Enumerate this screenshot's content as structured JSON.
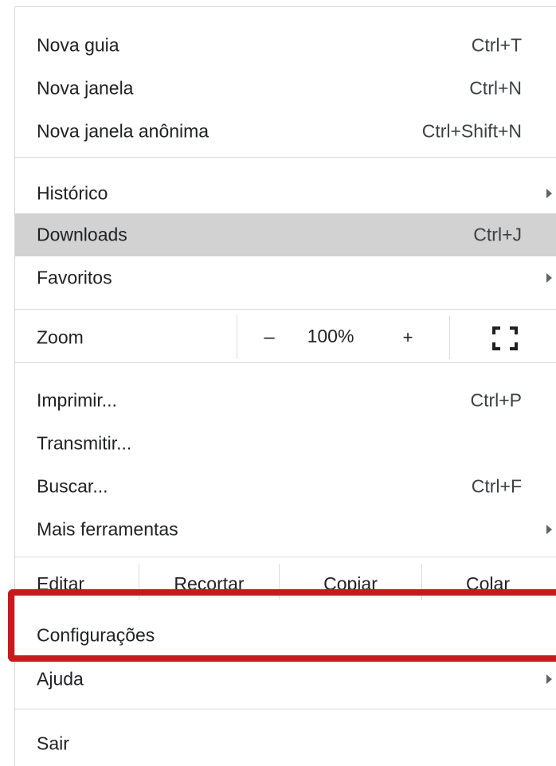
{
  "menu": {
    "new_tab": {
      "label": "Nova guia",
      "shortcut": "Ctrl+T"
    },
    "new_window": {
      "label": "Nova janela",
      "shortcut": "Ctrl+N"
    },
    "incognito": {
      "label": "Nova janela anônima",
      "shortcut": "Ctrl+Shift+N"
    },
    "history": {
      "label": "Histórico"
    },
    "downloads": {
      "label": "Downloads",
      "shortcut": "Ctrl+J"
    },
    "bookmarks": {
      "label": "Favoritos"
    },
    "zoom": {
      "label": "Zoom",
      "minus": "–",
      "value": "100%",
      "plus": "+",
      "fullscreen_icon": "fullscreen-icon"
    },
    "print": {
      "label": "Imprimir...",
      "shortcut": "Ctrl+P"
    },
    "cast": {
      "label": "Transmitir..."
    },
    "find": {
      "label": "Buscar...",
      "shortcut": "Ctrl+F"
    },
    "more_tools": {
      "label": "Mais ferramentas"
    },
    "edit": {
      "label": "Editar",
      "cut": "Recortar",
      "copy": "Copiar",
      "paste": "Colar"
    },
    "settings": {
      "label": "Configurações"
    },
    "help": {
      "label": "Ajuda"
    },
    "exit": {
      "label": "Sair"
    }
  },
  "colors": {
    "highlight_row": "#d2d2d2",
    "annotation_box": "#c8191c"
  }
}
